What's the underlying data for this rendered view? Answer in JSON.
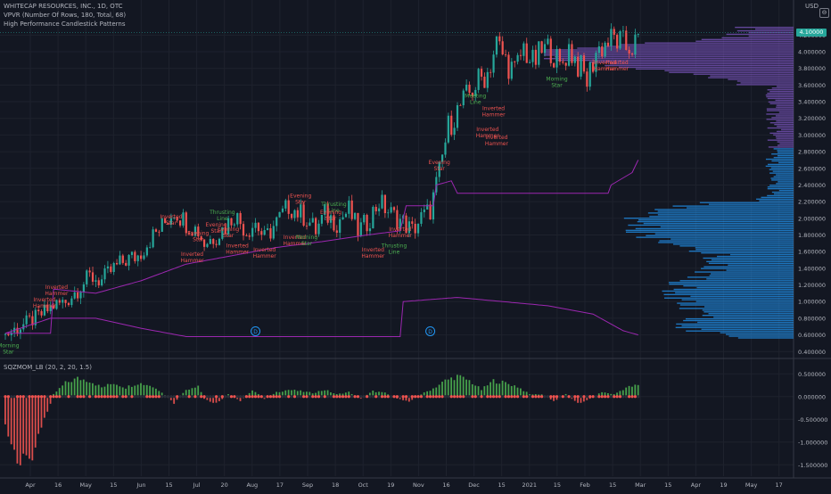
{
  "header": {
    "symbol_line": "WHITECAP RESOURCES, INC., 1D, OTC",
    "vpvr_line": "VPVR (Number Of Rows, 180, Total, 68)",
    "patterns_line": "High Performance Candlestick Patterns",
    "currency": "USD",
    "last_price": "4.10000"
  },
  "oscillator": {
    "label": "SQZMOM_LB (20, 2, 20, 1.5)"
  },
  "colors": {
    "background": "#131722",
    "grid": "#1e222d",
    "up": "#26a69a",
    "down": "#ef5350",
    "ma": "#9c27b0",
    "vp_upper": "#7e57c2",
    "vp_lower": "#2196f3",
    "bull_label": "#4caf50",
    "bear_label": "#ef5350",
    "hist_green": "#4caf50",
    "hist_red": "#ef5350"
  },
  "chart_data": {
    "type": "candlestick",
    "price_axis": {
      "ticks": [
        "4.200000",
        "4.000000",
        "3.800000",
        "3.600000",
        "3.400000",
        "3.200000",
        "3.000000",
        "2.800000",
        "2.600000",
        "2.400000",
        "2.200000",
        "2.000000",
        "1.800000",
        "1.600000",
        "1.400000",
        "1.200000",
        "1.000000",
        "0.800000",
        "0.600000",
        "0.400000"
      ],
      "ylim": [
        0.36,
        4.3
      ]
    },
    "osc_axis": {
      "ticks": [
        "0.500000",
        "0.000000",
        "-0.500000",
        "-1.000000",
        "-1.500000"
      ],
      "ylim": [
        -1.75,
        0.8
      ]
    },
    "time_axis": [
      "Apr",
      "16",
      "May",
      "15",
      "Jun",
      "15",
      "Jul",
      "20",
      "Aug",
      "17",
      "Sep",
      "18",
      "Oct",
      "19",
      "Nov",
      "16",
      "Dec",
      "15",
      "2021",
      "15",
      "Feb",
      "15",
      "Mar",
      "15",
      "Apr",
      "19",
      "May",
      "17"
    ],
    "close_path": [
      [
        0,
        0.6
      ],
      [
        6,
        0.72
      ],
      [
        11,
        0.82
      ],
      [
        16,
        0.95
      ],
      [
        20,
        1.0
      ],
      [
        24,
        1.15
      ],
      [
        28,
        1.3
      ],
      [
        32,
        1.25
      ],
      [
        36,
        1.4
      ],
      [
        40,
        1.5
      ],
      [
        44,
        1.55
      ],
      [
        48,
        1.75
      ],
      [
        52,
        1.9
      ],
      [
        56,
        2.1
      ],
      [
        60,
        1.95
      ],
      [
        64,
        1.85
      ],
      [
        66,
        1.7
      ],
      [
        70,
        1.8
      ],
      [
        73,
        1.9
      ],
      [
        76,
        2.05
      ],
      [
        80,
        1.85
      ],
      [
        83,
        1.95
      ],
      [
        86,
        1.75
      ],
      [
        90,
        1.95
      ],
      [
        94,
        2.15
      ],
      [
        98,
        2.05
      ],
      [
        100,
        2.0
      ],
      [
        103,
        1.85
      ],
      [
        106,
        2.05
      ],
      [
        110,
        1.95
      ],
      [
        114,
        2.1
      ],
      [
        117,
        1.85
      ],
      [
        120,
        1.95
      ],
      [
        124,
        2.2
      ],
      [
        128,
        2.05
      ],
      [
        132,
        1.95
      ],
      [
        135,
        1.85
      ],
      [
        138,
        2.0
      ],
      [
        141,
        2.1
      ],
      [
        144,
        2.55
      ],
      [
        147,
        3.1
      ],
      [
        151,
        3.35
      ],
      [
        154,
        3.5
      ],
      [
        157,
        3.65
      ],
      [
        160,
        3.75
      ],
      [
        163,
        4.1
      ],
      [
        166,
        3.9
      ],
      [
        169,
        3.75
      ],
      [
        172,
        4.05
      ],
      [
        175,
        3.85
      ],
      [
        178,
        4.0
      ],
      [
        181,
        4.05
      ],
      [
        184,
        3.8
      ],
      [
        187,
        4.05
      ],
      [
        190,
        3.85
      ],
      [
        193,
        3.65
      ],
      [
        196,
        4.0
      ],
      [
        199,
        4.1
      ],
      [
        202,
        4.15
      ],
      [
        206,
        4.05
      ],
      [
        210,
        4.1
      ]
    ],
    "ma_path": [
      [
        0,
        0.62
      ],
      [
        15,
        0.62
      ],
      [
        16,
        1.15
      ],
      [
        30,
        1.1
      ],
      [
        45,
        1.25
      ],
      [
        60,
        1.45
      ],
      [
        75,
        1.55
      ],
      [
        90,
        1.65
      ],
      [
        105,
        1.72
      ],
      [
        120,
        1.8
      ],
      [
        131,
        1.85
      ],
      [
        133,
        2.15
      ],
      [
        142,
        2.15
      ],
      [
        143,
        2.4
      ],
      [
        148,
        2.45
      ],
      [
        150,
        2.3
      ],
      [
        200,
        2.3
      ],
      [
        201,
        2.4
      ],
      [
        208,
        2.55
      ],
      [
        210,
        2.7
      ]
    ],
    "lower_line": [
      [
        0,
        0.62
      ],
      [
        15,
        0.8
      ],
      [
        30,
        0.8
      ],
      [
        45,
        0.68
      ],
      [
        60,
        0.58
      ],
      [
        131,
        0.58
      ],
      [
        132,
        1.0
      ],
      [
        150,
        1.05
      ],
      [
        165,
        1.0
      ],
      [
        180,
        0.95
      ],
      [
        195,
        0.85
      ],
      [
        205,
        0.65
      ],
      [
        210,
        0.6
      ]
    ],
    "volume_profile": {
      "price_range": [
        0.55,
        4.3
      ],
      "rows": 180,
      "split_price": 2.85
    },
    "osc_hist_envelope": [
      [
        0,
        -0.6
      ],
      [
        4,
        -1.55
      ],
      [
        8,
        -1.4
      ],
      [
        12,
        -0.7
      ],
      [
        16,
        0.05
      ],
      [
        20,
        0.3
      ],
      [
        24,
        0.4
      ],
      [
        28,
        0.35
      ],
      [
        32,
        0.2
      ],
      [
        36,
        0.3
      ],
      [
        40,
        0.2
      ],
      [
        44,
        0.3
      ],
      [
        48,
        0.25
      ],
      [
        52,
        0.1
      ],
      [
        56,
        -0.15
      ],
      [
        60,
        0.15
      ],
      [
        64,
        0.25
      ],
      [
        66,
        -0.05
      ],
      [
        70,
        -0.15
      ],
      [
        74,
        0.05
      ],
      [
        78,
        -0.1
      ],
      [
        82,
        0.15
      ],
      [
        86,
        -0.05
      ],
      [
        90,
        0.1
      ],
      [
        94,
        0.15
      ],
      [
        98,
        0.12
      ],
      [
        102,
        0.08
      ],
      [
        106,
        0.15
      ],
      [
        110,
        0.05
      ],
      [
        114,
        0.1
      ],
      [
        118,
        -0.05
      ],
      [
        122,
        0.12
      ],
      [
        126,
        0.08
      ],
      [
        130,
        -0.05
      ],
      [
        134,
        -0.1
      ],
      [
        138,
        0.05
      ],
      [
        142,
        0.18
      ],
      [
        146,
        0.35
      ],
      [
        150,
        0.45
      ],
      [
        154,
        0.35
      ],
      [
        158,
        0.15
      ],
      [
        162,
        0.35
      ],
      [
        166,
        0.3
      ],
      [
        170,
        0.22
      ],
      [
        174,
        0.05
      ],
      [
        178,
        0.05
      ],
      [
        182,
        -0.1
      ],
      [
        186,
        0.05
      ],
      [
        190,
        -0.15
      ],
      [
        194,
        -0.05
      ],
      [
        198,
        0.1
      ],
      [
        202,
        0.05
      ],
      [
        206,
        0.2
      ],
      [
        210,
        0.25
      ]
    ],
    "pattern_labels": [
      {
        "i": 1,
        "p": 0.45,
        "text": "Morning Star",
        "kind": "bull"
      },
      {
        "i": 13,
        "p": 1.0,
        "text": "Inverted Hammer",
        "kind": "bear"
      },
      {
        "i": 17,
        "p": 1.15,
        "text": "Inverted Hammer",
        "kind": "bear"
      },
      {
        "i": 55,
        "p": 2.0,
        "text": "Inverted Star",
        "kind": "bear"
      },
      {
        "i": 62,
        "p": 1.55,
        "text": "Inverted Hammer",
        "kind": "bear"
      },
      {
        "i": 64,
        "p": 1.8,
        "text": "Evening Star",
        "kind": "bear"
      },
      {
        "i": 72,
        "p": 2.05,
        "text": "Thrusting Line",
        "kind": "bull"
      },
      {
        "i": 70,
        "p": 1.9,
        "text": "Evening Star",
        "kind": "bear"
      },
      {
        "i": 74,
        "p": 1.85,
        "text": "Evening Star",
        "kind": "bear"
      },
      {
        "i": 77,
        "p": 1.65,
        "text": "Inverted Hammer",
        "kind": "bear"
      },
      {
        "i": 86,
        "p": 1.6,
        "text": "Inverted Hammer",
        "kind": "bear"
      },
      {
        "i": 98,
        "p": 2.25,
        "text": "Evening Star",
        "kind": "bear"
      },
      {
        "i": 96,
        "p": 1.75,
        "text": "Inverted Hammer",
        "kind": "bear"
      },
      {
        "i": 100,
        "p": 1.75,
        "text": "Morning Star",
        "kind": "bull"
      },
      {
        "i": 109,
        "p": 2.15,
        "text": "Thrusting Line",
        "kind": "bull"
      },
      {
        "i": 108,
        "p": 2.05,
        "text": "Evening Star",
        "kind": "bear"
      },
      {
        "i": 122,
        "p": 1.6,
        "text": "Inverted Hammer",
        "kind": "bear"
      },
      {
        "i": 129,
        "p": 1.65,
        "text": "Thrusting Line",
        "kind": "bull"
      },
      {
        "i": 131,
        "p": 1.85,
        "text": "Inverted Hammer",
        "kind": "bear"
      },
      {
        "i": 144,
        "p": 2.65,
        "text": "Evening Star",
        "kind": "bear"
      },
      {
        "i": 156,
        "p": 3.45,
        "text": "Meeting Line",
        "kind": "bull"
      },
      {
        "i": 162,
        "p": 3.3,
        "text": "Inverted Hammer",
        "kind": "bear"
      },
      {
        "i": 160,
        "p": 3.05,
        "text": "Inverted Hammer",
        "kind": "bear"
      },
      {
        "i": 163,
        "p": 2.95,
        "text": "Inverted Hammer",
        "kind": "bear"
      },
      {
        "i": 183,
        "p": 3.65,
        "text": "Morning Star",
        "kind": "bull"
      },
      {
        "i": 199,
        "p": 3.85,
        "text": "Inverted Hammer",
        "kind": "bear"
      },
      {
        "i": 203,
        "p": 3.85,
        "text": "Inverted Hammer",
        "kind": "bear"
      }
    ]
  }
}
